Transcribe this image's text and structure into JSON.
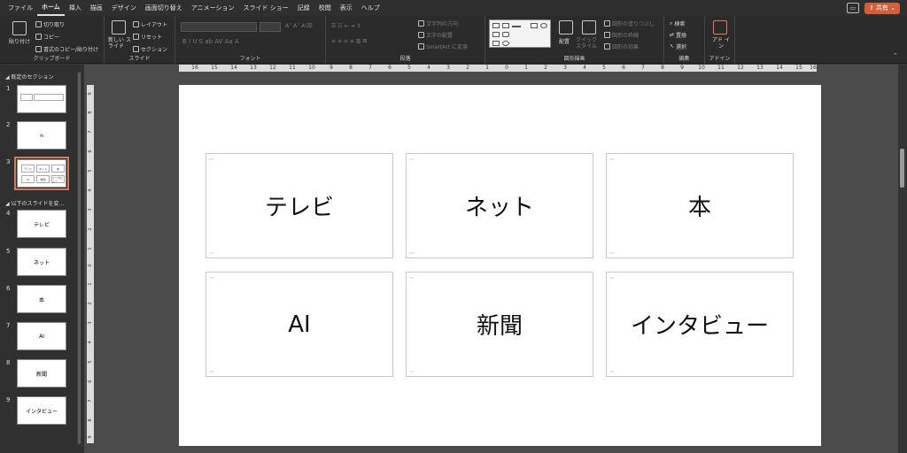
{
  "menu": {
    "tabs": [
      "ファイル",
      "ホーム",
      "挿入",
      "描画",
      "デザイン",
      "画面切り替え",
      "アニメーション",
      "スライド ショー",
      "記録",
      "校閲",
      "表示",
      "ヘルプ"
    ],
    "active_tab": "ホーム",
    "share_label": "共有"
  },
  "ribbon": {
    "clipboard": {
      "label": "クリップボード",
      "paste": "貼り付け",
      "cut": "切り取り",
      "copy": "コピー",
      "format_painter": "書式のコピー/貼り付け"
    },
    "slides": {
      "label": "スライド",
      "new_slide": "新しい スライド",
      "layout": "レイアウト",
      "reset": "リセット",
      "section": "セクション"
    },
    "font": {
      "label": "フォント"
    },
    "paragraph": {
      "label": "段落",
      "text_direction": "文字列の方向",
      "align_text": "文字の配置",
      "smartart": "SmartArt に変換"
    },
    "drawing": {
      "label": "図形描画",
      "arrange": "配置",
      "quick_styles": "クイック スタイル",
      "shape_fill": "図形の塗りつぶし",
      "shape_outline": "図形の枠線",
      "shape_effects": "図形の効果"
    },
    "editing": {
      "label": "編集",
      "find": "検索",
      "replace": "置換",
      "select": "選択"
    },
    "addins": {
      "label": "アドイン",
      "addin": "アド イン"
    }
  },
  "thumbnails": {
    "section1": "既定のセクション",
    "section2": "以下のスライドを変…",
    "slides": [
      {
        "num": "1",
        "label": ""
      },
      {
        "num": "2",
        "label": "AI"
      },
      {
        "num": "3",
        "label": ""
      },
      {
        "num": "4",
        "label": "テレビ"
      },
      {
        "num": "5",
        "label": "ネット"
      },
      {
        "num": "6",
        "label": "本"
      },
      {
        "num": "7",
        "label": "AI"
      },
      {
        "num": "8",
        "label": "新聞"
      },
      {
        "num": "9",
        "label": "インタビュー"
      }
    ]
  },
  "ruler": {
    "h_ticks": [
      "16",
      "15",
      "14",
      "13",
      "12",
      "11",
      "10",
      "9",
      "8",
      "7",
      "6",
      "5",
      "4",
      "3",
      "2",
      "1",
      "0",
      "1",
      "2",
      "3",
      "4",
      "5",
      "6",
      "7",
      "8",
      "9",
      "10",
      "11",
      "12",
      "13",
      "14",
      "15",
      "16"
    ],
    "v_ticks": [
      "9",
      "8",
      "7",
      "6",
      "5",
      "4",
      "3",
      "2",
      "1",
      "0",
      "1",
      "2",
      "3",
      "4",
      "5",
      "6",
      "7",
      "8",
      "9"
    ]
  },
  "slide": {
    "cards": [
      "テレビ",
      "ネット",
      "本",
      "AI",
      "新聞",
      "インタビュー"
    ]
  }
}
